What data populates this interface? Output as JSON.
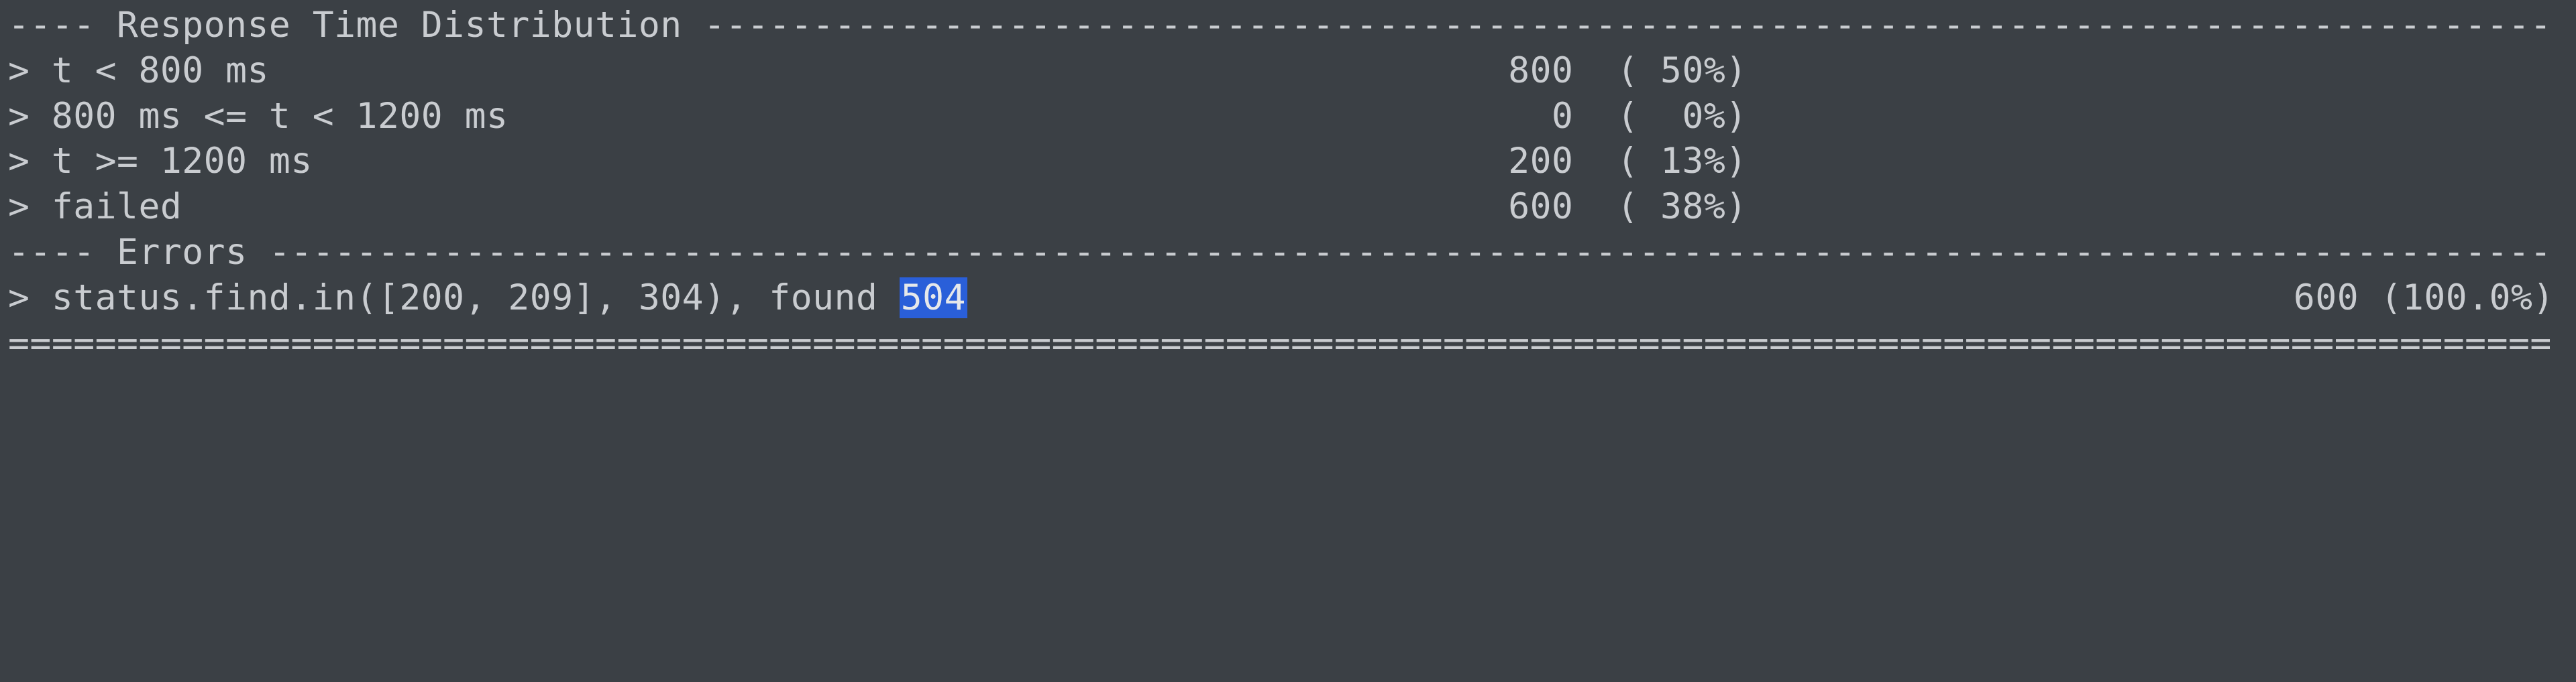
{
  "sections": {
    "rtd": {
      "title": "Response Time Distribution",
      "rows": [
        {
          "label": "t < 800 ms",
          "count": "800",
          "pct": "50%"
        },
        {
          "label": "800 ms <= t < 1200 ms",
          "count": "0",
          "pct": "0%"
        },
        {
          "label": "t >= 1200 ms",
          "count": "200",
          "pct": "13%"
        },
        {
          "label": "failed",
          "count": "600",
          "pct": "38%"
        }
      ]
    },
    "errors": {
      "title": "Errors",
      "rows": [
        {
          "prefix": "status.find.in([200, 209], 304), found ",
          "found_code": "504",
          "count": "600",
          "pct": "100.0%"
        }
      ]
    }
  },
  "layout": {
    "line_cols": 117,
    "dash_char": "-",
    "eq_char": "=",
    "count_col_end": 72,
    "pct_col_end": 80
  }
}
